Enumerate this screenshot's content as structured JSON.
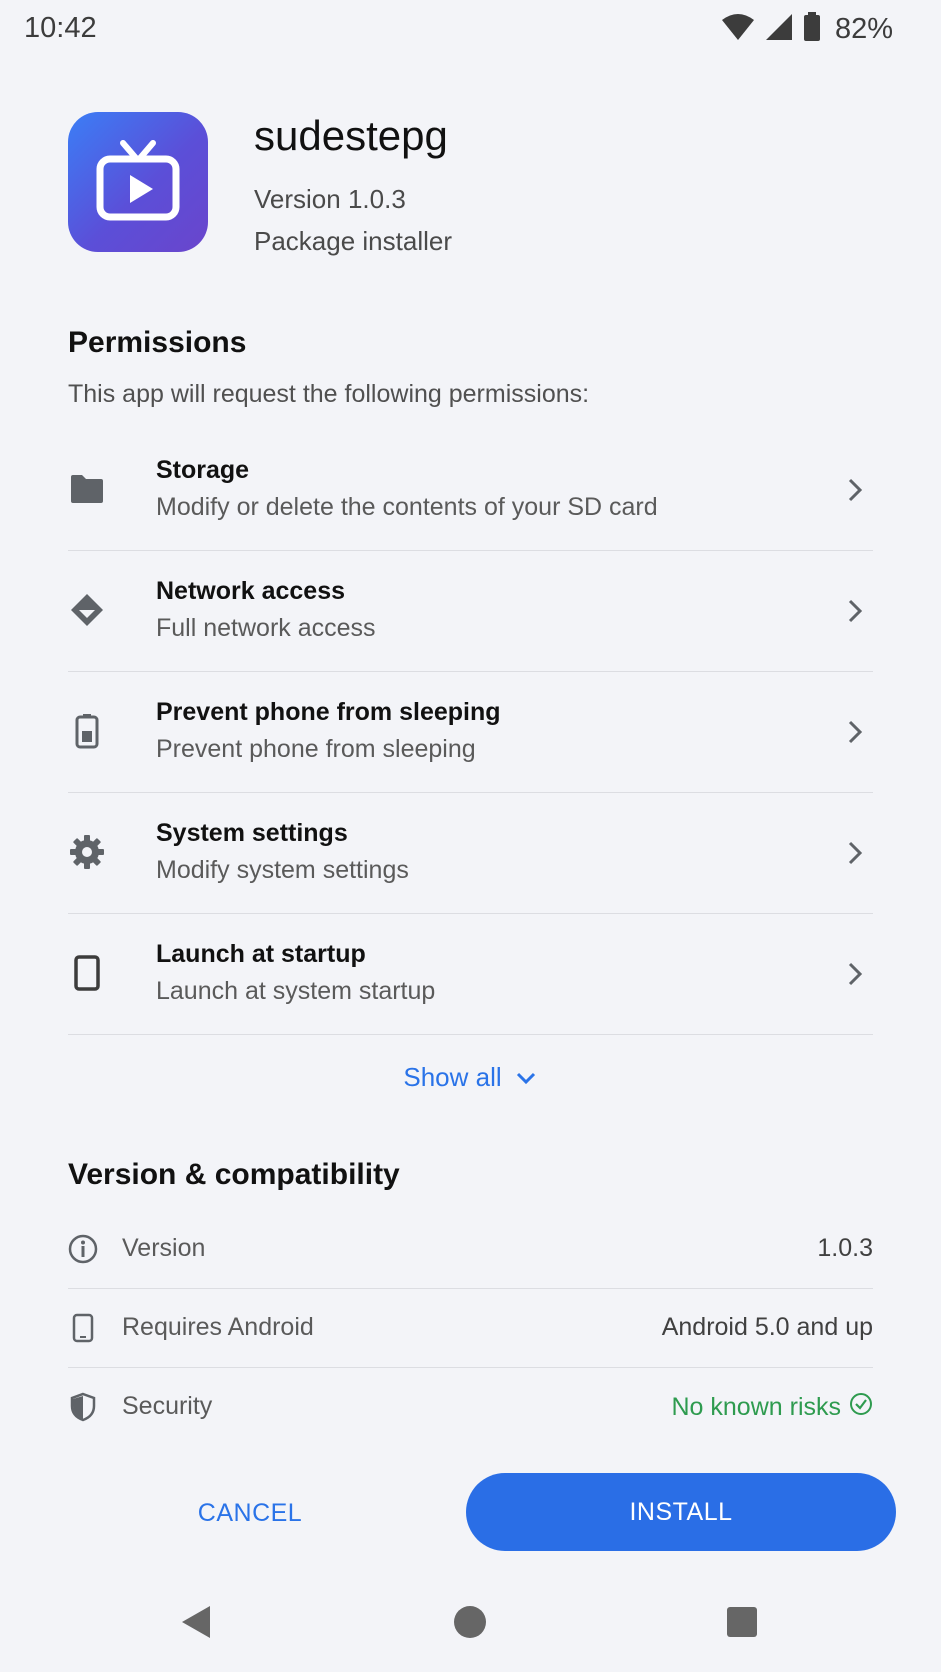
{
  "status_bar": {
    "time": "10:42",
    "battery": "82%"
  },
  "app": {
    "name": "sudestepg",
    "version": "Version 1.0.3",
    "installer": "Package installer",
    "icon": "tv-play-icon"
  },
  "permissions": {
    "title": "Permissions",
    "subtitle": "This app will request the following permissions:",
    "items": [
      {
        "icon": "folder-icon",
        "title": "Storage",
        "description": "Modify or delete the contents of your SD card"
      },
      {
        "icon": "network-icon",
        "title": "Network access",
        "description": "Full network access"
      },
      {
        "icon": "battery-icon",
        "title": "Prevent phone from sleeping",
        "description": "Prevent phone from sleeping"
      },
      {
        "icon": "gear-icon",
        "title": "System settings",
        "description": "Modify system settings"
      },
      {
        "icon": "phone-icon",
        "title": "Launch at startup",
        "description": "Launch at system startup"
      }
    ],
    "show_all": "Show all"
  },
  "compatibility": {
    "title": "Version & compatibility",
    "rows": [
      {
        "icon": "info-icon",
        "label": "Version",
        "value": "1.0.3"
      },
      {
        "icon": "phone-icon",
        "label": "Requires Android",
        "value": "Android 5.0 and up"
      },
      {
        "icon": "shield-icon",
        "label": "Security",
        "value": "No known risks"
      }
    ]
  },
  "actions": {
    "cancel": "CANCEL",
    "install": "INSTALL"
  },
  "colors": {
    "accent": "#2a6ee6",
    "ok": "#2e9b4f",
    "background": "#f3f4f8"
  }
}
